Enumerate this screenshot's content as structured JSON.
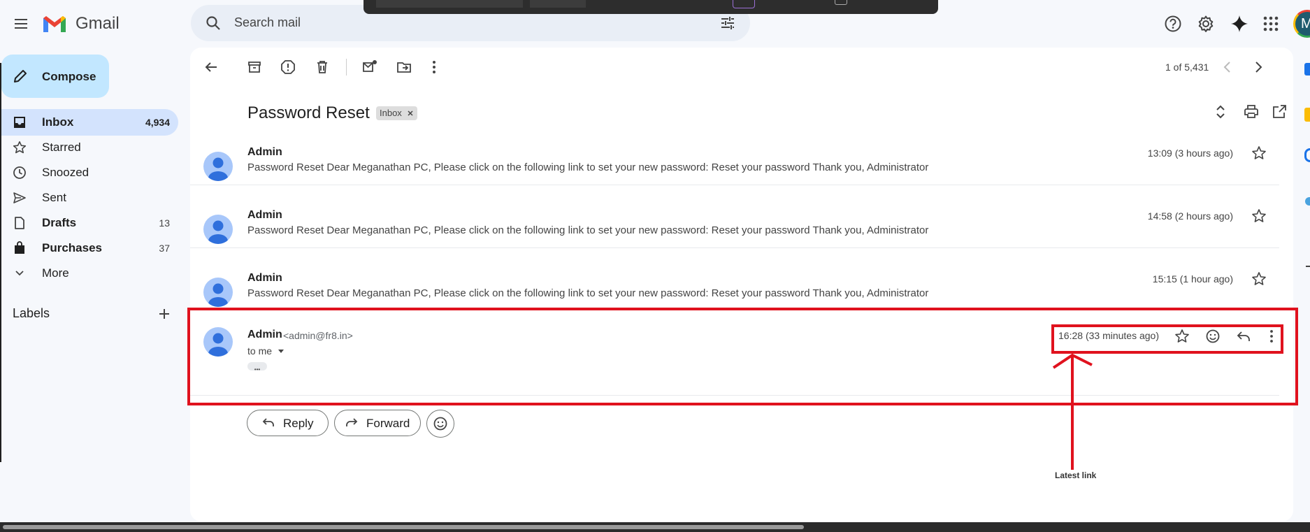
{
  "header": {
    "app_name": "Gmail",
    "search_placeholder": "Search mail",
    "avatar_letter": "M"
  },
  "compose": {
    "label": "Compose"
  },
  "sidebar": {
    "items": [
      {
        "label": "Inbox",
        "count": "4,934",
        "active": true,
        "icon": "inbox-icon"
      },
      {
        "label": "Starred",
        "count": "",
        "icon": "star-icon"
      },
      {
        "label": "Snoozed",
        "count": "",
        "icon": "clock-icon"
      },
      {
        "label": "Sent",
        "count": "",
        "icon": "send-icon"
      },
      {
        "label": "Drafts",
        "count": "13",
        "icon": "draft-icon"
      },
      {
        "label": "Purchases",
        "count": "37",
        "icon": "bag-icon"
      },
      {
        "label": "More",
        "count": "",
        "icon": "chevron-down-icon"
      }
    ],
    "labels_title": "Labels"
  },
  "toolbar": {
    "pagination": "1 of 5,431"
  },
  "thread": {
    "subject": "Password Reset",
    "label_chip": "Inbox",
    "messages": [
      {
        "sender": "Admin",
        "snippet": "Password Reset Dear Meganathan PC, Please click on the following link to set your new password: Reset your password Thank you, Administrator",
        "time": "13:09 (3 hours ago)"
      },
      {
        "sender": "Admin",
        "snippet": "Password Reset Dear Meganathan PC, Please click on the following link to set your new password: Reset your password Thank you, Administrator",
        "time": "14:58 (2 hours ago)"
      },
      {
        "sender": "Admin",
        "snippet": "Password Reset Dear Meganathan PC, Please click on the following link to set your new password: Reset your password Thank you, Administrator",
        "time": "15:15 (1 hour ago)"
      }
    ],
    "expanded": {
      "sender": "Admin",
      "email": "<admin@fr8.in>",
      "to": "to me",
      "time": "16:28 (33 minutes ago)",
      "ellipsis": "•••"
    }
  },
  "actions": {
    "reply": "Reply",
    "forward": "Forward"
  },
  "annotation": {
    "text": "Latest link",
    "color": "#e0121e"
  }
}
